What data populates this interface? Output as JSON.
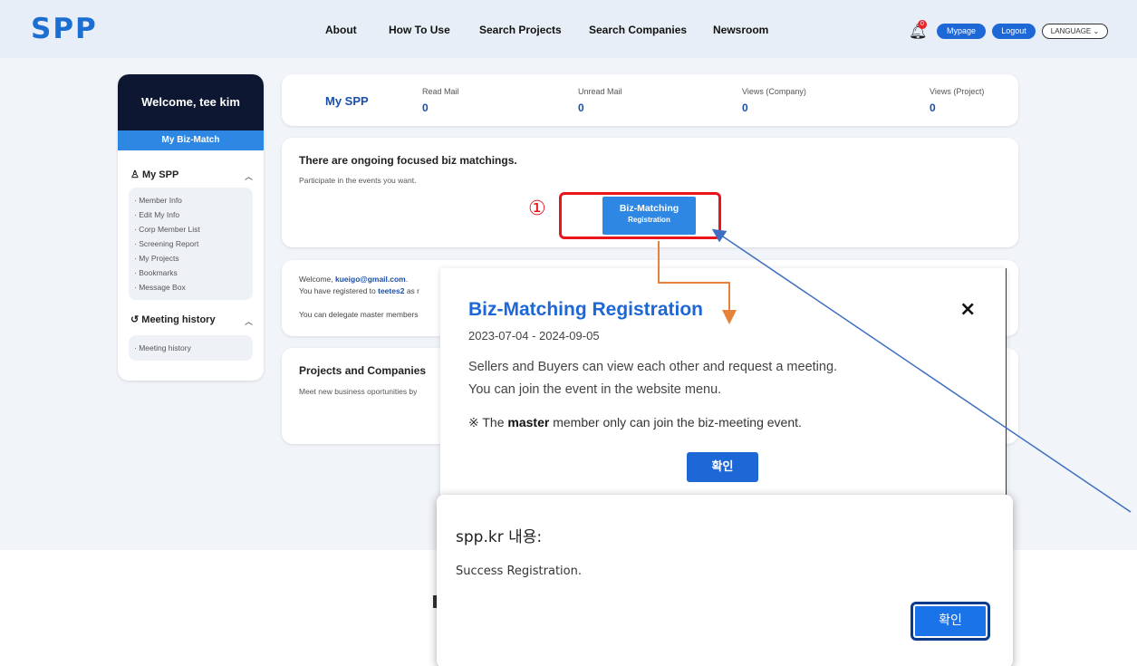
{
  "header": {
    "logo": "SPP",
    "nav": [
      "About",
      "How To Use",
      "Search Projects",
      "Search Companies",
      "Newsroom"
    ],
    "notification_count": "0",
    "mypage": "Mypage",
    "logout": "Logout",
    "language": "LANGUAGE ⌄"
  },
  "sidebar": {
    "welcome": "Welcome, tee kim",
    "tab": "My Biz-Match",
    "my_spp": {
      "heading": "My SPP",
      "items": [
        "· Member Info",
        "· Edit My Info",
        "· Corp Member List",
        "· Screening Report",
        "· My Projects",
        "· Bookmarks",
        "· Message Box"
      ]
    },
    "meeting": {
      "heading": "Meeting history",
      "items": [
        "· Meeting history"
      ]
    }
  },
  "stats": {
    "title": "My SPP",
    "items": [
      {
        "label": "Read Mail",
        "value": "0"
      },
      {
        "label": "Unread Mail",
        "value": "0"
      },
      {
        "label": "Views (Company)",
        "value": "0"
      },
      {
        "label": "Views (Project)",
        "value": "0"
      }
    ]
  },
  "focus": {
    "title": "There are ongoing focused biz matchings.",
    "subtitle": "Participate in the events you want.",
    "button_line1": "Biz-Matching",
    "button_line2": "Registration"
  },
  "member": {
    "welcome_prefix": "Welcome,",
    "email": "kueigo@gmail.com",
    "email_suffix": ".",
    "registered_prefix": "You have registered to",
    "company": "teetes2",
    "registered_suffix": "as r",
    "delegate": "You can delegate master members"
  },
  "projects": {
    "title": "Projects and Companies",
    "subtitle": "Meet new business oportunities by"
  },
  "annotation": {
    "step": "①",
    "color": "#e8151d",
    "arrow_orange": "#e6823a",
    "arrow_blue": "#3f6fc0"
  },
  "modal": {
    "title": "Biz-Matching Registration",
    "dates": "2023-07-04 - 2024-09-05",
    "desc1": "Sellers and Buyers can view each other and request a meeting.",
    "desc2": "You can join the event in the website menu.",
    "note_prefix": "※ The",
    "note_bold": "master",
    "note_suffix": "member only can join the biz-meeting event.",
    "confirm": "확인",
    "close_icon": "×"
  },
  "alert": {
    "title": "spp.kr 내용:",
    "message": "Success Registration.",
    "ok": "확인"
  }
}
